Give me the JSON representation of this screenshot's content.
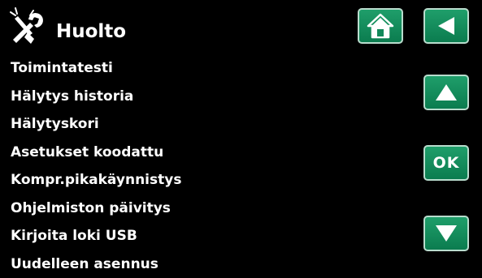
{
  "header": {
    "title": "Huolto",
    "icon": "tools-icon"
  },
  "menu": {
    "items": [
      {
        "label": "Toimintatesti"
      },
      {
        "label": "Hälytys historia"
      },
      {
        "label": "Hälytyskori"
      },
      {
        "label": "Asetukset koodattu"
      },
      {
        "label": "Kompr.pikakäynnistys"
      },
      {
        "label": "Ohjelmiston päivitys"
      },
      {
        "label": "Kirjoita loki USB"
      },
      {
        "label": "Uudelleen asennus"
      }
    ]
  },
  "buttons": {
    "home": {
      "icon": "home-icon"
    },
    "back": {
      "icon": "back-arrow-icon"
    },
    "up": {
      "icon": "arrow-up-icon"
    },
    "ok": {
      "label": "OK"
    },
    "down": {
      "icon": "arrow-down-icon"
    }
  },
  "colors": {
    "background": "#000000",
    "button_fill": "#13895b",
    "button_border": "#b9dccd",
    "text": "#ffffff"
  }
}
